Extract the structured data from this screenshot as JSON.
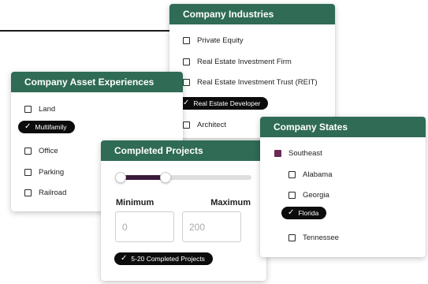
{
  "industries": {
    "title": "Company Industries",
    "items": [
      {
        "label": "Private Equity",
        "checked": false
      },
      {
        "label": "Real Estate Investment Firm",
        "checked": false
      },
      {
        "label": "Real Estate Investment Trust (REIT)",
        "checked": false
      },
      {
        "label": "Real Estate Developer",
        "checked": true
      },
      {
        "label": "Architect",
        "checked": false
      }
    ]
  },
  "asset": {
    "title": "Company Asset Experiences",
    "items": [
      {
        "label": "Land",
        "checked": false
      },
      {
        "label": "Multifamily",
        "checked": true
      },
      {
        "label": "Office",
        "checked": false
      },
      {
        "label": "Parking",
        "checked": false
      },
      {
        "label": "Railroad",
        "checked": false
      }
    ]
  },
  "projects": {
    "title": "Completed Projects",
    "min_label": "Minimum",
    "max_label": "Maximum",
    "min_placeholder": "0",
    "max_placeholder": "200",
    "selected_range": [
      5,
      20
    ],
    "pill_label": "5-20 Completed Projects"
  },
  "states": {
    "title": "Company States",
    "region": {
      "label": "Southeast",
      "checked": true
    },
    "items": [
      {
        "label": "Alabama",
        "checked": false
      },
      {
        "label": "Georgia",
        "checked": false
      },
      {
        "label": "Florida",
        "checked": true
      },
      {
        "label": "Tennessee",
        "checked": false
      }
    ]
  },
  "colors": {
    "header": "#2f6b55",
    "pill": "#0c0c0c",
    "checked_box": "#6c2a57",
    "slider_fill": "#3a1a3a"
  },
  "icons": {
    "checkmark": "check-icon",
    "checkbox": "checkbox-icon"
  }
}
